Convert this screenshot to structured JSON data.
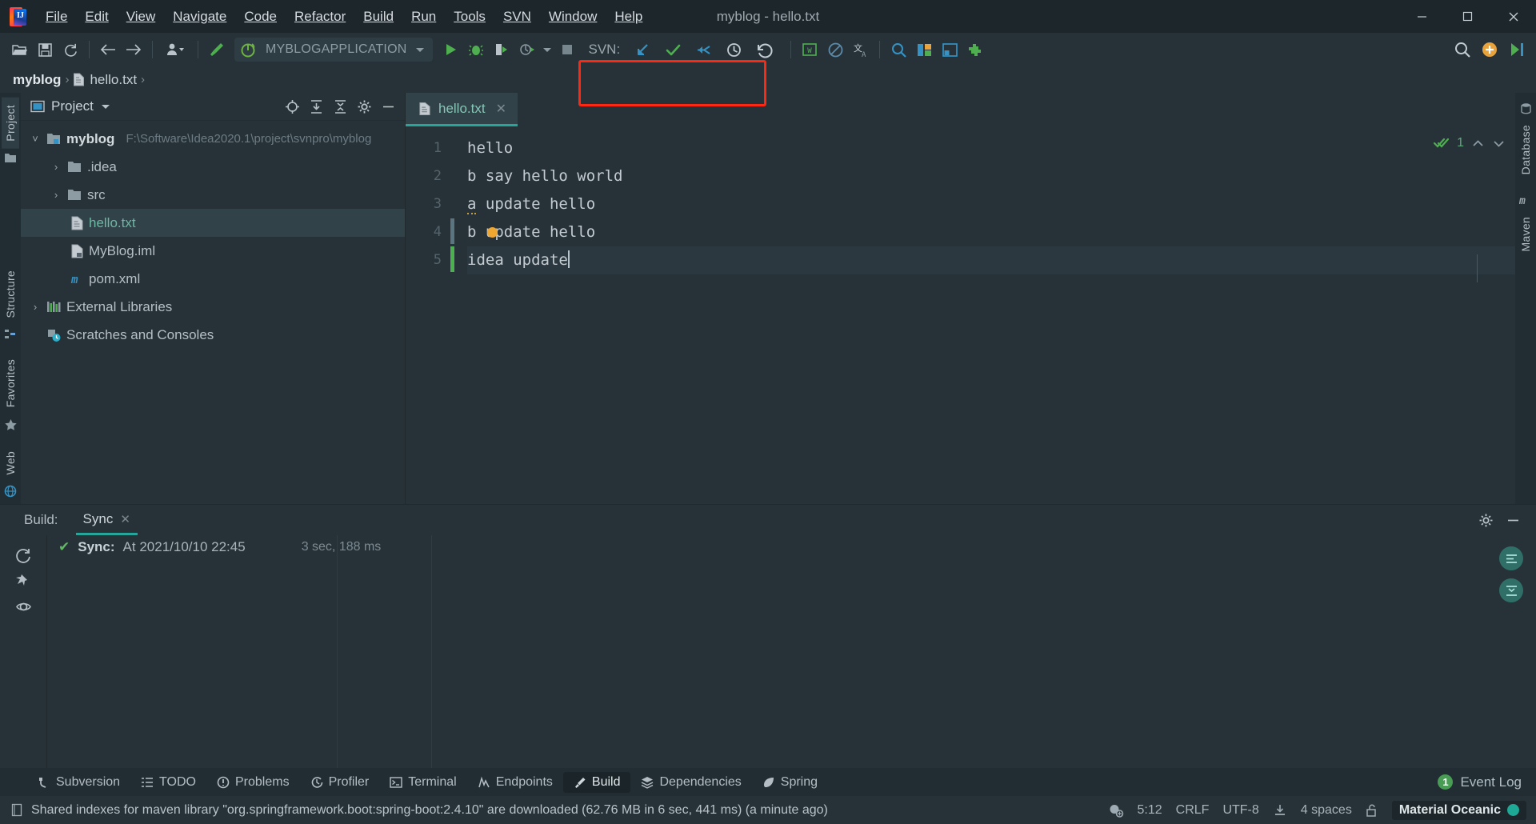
{
  "window": {
    "title": "myblog - hello.txt",
    "minimize_label": "—",
    "maximize_label": "❐",
    "close_label": "✕"
  },
  "menu": {
    "items": [
      {
        "label": "File"
      },
      {
        "label": "Edit"
      },
      {
        "label": "View"
      },
      {
        "label": "Navigate"
      },
      {
        "label": "Code"
      },
      {
        "label": "Refactor"
      },
      {
        "label": "Build"
      },
      {
        "label": "Run"
      },
      {
        "label": "Tools"
      },
      {
        "label": "SVN"
      },
      {
        "label": "Window"
      },
      {
        "label": "Help"
      }
    ]
  },
  "toolbar": {
    "open_icon": "open-folder-icon",
    "save_icon": "save-icon",
    "sync_icon": "refresh-icon",
    "back_icon": "back-arrow-icon",
    "forward_icon": "forward-arrow-icon",
    "profile_icon": "user-profile-icon",
    "build_icon": "hammer-icon",
    "run_config": "MYBLOGAPPLICATION",
    "run_icon": "run-icon",
    "debug_icon": "debug-icon",
    "coverage_icon": "run-with-coverage-icon",
    "profiler_icon": "profiler-icon",
    "stop_icon": "stop-icon",
    "svn": {
      "label": "SVN:",
      "update_icon": "svn-update-icon",
      "commit_icon": "svn-commit-icon",
      "merge_icon": "svn-merge-icon",
      "history_icon": "svn-history-icon",
      "revert_icon": "svn-revert-icon",
      "highlight_color": "#fe2712"
    },
    "right": {
      "search_icon": "search-everywhere-icon",
      "update_app_icon": "ide-update-icon",
      "run_anything_icon": "run-anything-icon"
    }
  },
  "breadcrumb": {
    "project": "myblog",
    "file": "hello.txt",
    "separator": "›"
  },
  "left_stripe": {
    "items": [
      {
        "label": "Project",
        "active": true
      },
      {
        "label": "Structure",
        "active": false
      },
      {
        "label": "Favorites",
        "active": false
      },
      {
        "label": "Web",
        "active": false
      }
    ]
  },
  "right_stripe": {
    "items": [
      {
        "label": "Database"
      },
      {
        "label": "Maven"
      }
    ]
  },
  "project_panel": {
    "title": "Project",
    "dropdown_icon": "chevron-down-icon",
    "icons": [
      {
        "name": "scroll-from-source-icon"
      },
      {
        "name": "expand-all-icon"
      },
      {
        "name": "collapse-all-icon"
      },
      {
        "name": "settings-gear-icon"
      },
      {
        "name": "hide-panel-icon"
      }
    ],
    "tree": [
      {
        "label": "myblog",
        "path": "F:\\Software\\Idea2020.1\\project\\svnpro\\myblog",
        "indent": 1,
        "arrow": "˅",
        "icon": "module-folder-icon",
        "bold": true,
        "selected": false,
        "color": "default"
      },
      {
        "label": ".idea",
        "path": "",
        "indent": 2,
        "arrow": "›",
        "icon": "folder-icon",
        "bold": false,
        "selected": false,
        "color": "default"
      },
      {
        "label": "src",
        "path": "",
        "indent": 2,
        "arrow": "›",
        "icon": "folder-icon",
        "bold": false,
        "selected": false,
        "color": "default"
      },
      {
        "label": "hello.txt",
        "path": "",
        "indent": 3,
        "arrow": "",
        "icon": "text-file-icon",
        "bold": false,
        "selected": true,
        "color": "green"
      },
      {
        "label": "MyBlog.iml",
        "path": "",
        "indent": 3,
        "arrow": "",
        "icon": "iml-file-icon",
        "bold": false,
        "selected": false,
        "color": "default"
      },
      {
        "label": "pom.xml",
        "path": "",
        "indent": 3,
        "arrow": "",
        "icon": "maven-pom-icon",
        "bold": false,
        "selected": false,
        "color": "default"
      },
      {
        "label": "External Libraries",
        "path": "",
        "indent": 1,
        "arrow": "›",
        "icon": "libraries-icon",
        "bold": false,
        "selected": false,
        "color": "default"
      },
      {
        "label": "Scratches and Consoles",
        "path": "",
        "indent": 1,
        "arrow": "",
        "icon": "scratches-icon",
        "bold": false,
        "selected": false,
        "color": "default"
      }
    ]
  },
  "editor": {
    "tab": {
      "label": "hello.txt",
      "icon": "text-file-icon",
      "close_icon": "close-icon"
    },
    "lines": [
      {
        "number": "1",
        "text": "hello",
        "change": "none",
        "caret": false
      },
      {
        "number": "2",
        "text": "b say hello world",
        "change": "none",
        "caret": false
      },
      {
        "number": "3",
        "text": "a update hello",
        "change": "none",
        "caret": false
      },
      {
        "number": "4",
        "text": "b update hello",
        "change": "modified",
        "caret": false
      },
      {
        "number": "5",
        "text": "idea update",
        "change": "added",
        "caret": true
      }
    ],
    "inspection": {
      "icon": "inspections-ok-icon",
      "count": "1",
      "prev_icon": "chevron-up-icon",
      "next_icon": "chevron-down-icon"
    },
    "colors": {
      "modified_bar": "#5a7480",
      "added_bar": "#4caf50",
      "tab_underline": "#26a69a"
    }
  },
  "build_panel": {
    "label": "Build:",
    "tab": {
      "label": "Sync",
      "close_icon": "close-icon"
    },
    "settings_icon": "settings-gear-icon",
    "hide_icon": "hide-panel-icon",
    "side_icons": [
      {
        "name": "rerun-icon"
      },
      {
        "name": "pin-tab-icon"
      },
      {
        "name": "toggle-soft-wrap-icon"
      }
    ],
    "result": {
      "status_icon": "success-check-icon",
      "title": "Sync:",
      "detail": "At 2021/10/10 22:45",
      "duration": "3 sec, 188 ms"
    },
    "float_icons": [
      {
        "name": "expand-tree-icon"
      },
      {
        "name": "collapse-tree-icon"
      }
    ]
  },
  "toolwindow_bar": {
    "tabs": [
      {
        "label": "Subversion",
        "icon": "subversion-icon",
        "active": false
      },
      {
        "label": "TODO",
        "icon": "todo-icon",
        "active": false
      },
      {
        "label": "Problems",
        "icon": "problems-icon",
        "active": false
      },
      {
        "label": "Profiler",
        "icon": "profiler-icon",
        "active": false
      },
      {
        "label": "Terminal",
        "icon": "terminal-icon",
        "active": false
      },
      {
        "label": "Endpoints",
        "icon": "endpoints-icon",
        "active": false
      },
      {
        "label": "Build",
        "icon": "build-hammer-icon",
        "active": true
      },
      {
        "label": "Dependencies",
        "icon": "dependencies-icon",
        "active": false
      },
      {
        "label": "Spring",
        "icon": "spring-leaf-icon",
        "active": false
      }
    ],
    "event_log": {
      "label": "Event Log",
      "count": "1"
    }
  },
  "status_bar": {
    "icon": "indexes-icon",
    "message": "Shared indexes for maven library \"org.springframework.boot:spring-boot:2.4.10\" are downloaded (62.76 MB in 6 sec, 441 ms) (a minute ago)",
    "position": "5:12",
    "line_separator": "CRLF",
    "encoding": "UTF-8",
    "download_icon": "download-indexes-icon",
    "indent": "4 spaces",
    "lock_icon": "unlocked-icon",
    "theme": "Material Oceanic",
    "inspection_icon": "inspection-profile-icon"
  }
}
